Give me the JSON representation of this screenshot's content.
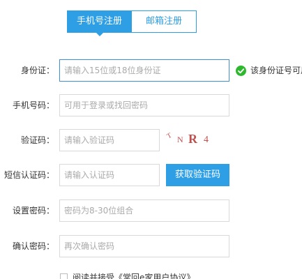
{
  "tabs": {
    "phone_label": "手机号注册",
    "email_label": "邮箱注册"
  },
  "fields": {
    "id_card": {
      "label": "身份证：",
      "placeholder": "请输入15位或18位身份证",
      "valid_message": "该身份证号可用"
    },
    "phone": {
      "label": "手机号码：",
      "placeholder": "可用于登录或找回密码"
    },
    "captcha": {
      "label": "验证码：",
      "placeholder": "请输入验证码",
      "chars": [
        "T",
        "N",
        "R",
        "4"
      ]
    },
    "sms": {
      "label": "短信认证码：",
      "placeholder": "请输入认证码",
      "button_label": "获取验证码"
    },
    "password": {
      "label": "设置密码：",
      "placeholder": "密码为8-30位组合"
    },
    "confirm_password": {
      "label": "确认密码：",
      "placeholder": "再次确认密码"
    }
  },
  "agreement": {
    "text": "阅读并接受《常回e家用户协议》"
  },
  "colors": {
    "accent": "#2e9ee5",
    "valid": "#2eb82e",
    "captcha_text": "#c0504d"
  },
  "icons": {
    "valid": "check-circle-icon"
  }
}
